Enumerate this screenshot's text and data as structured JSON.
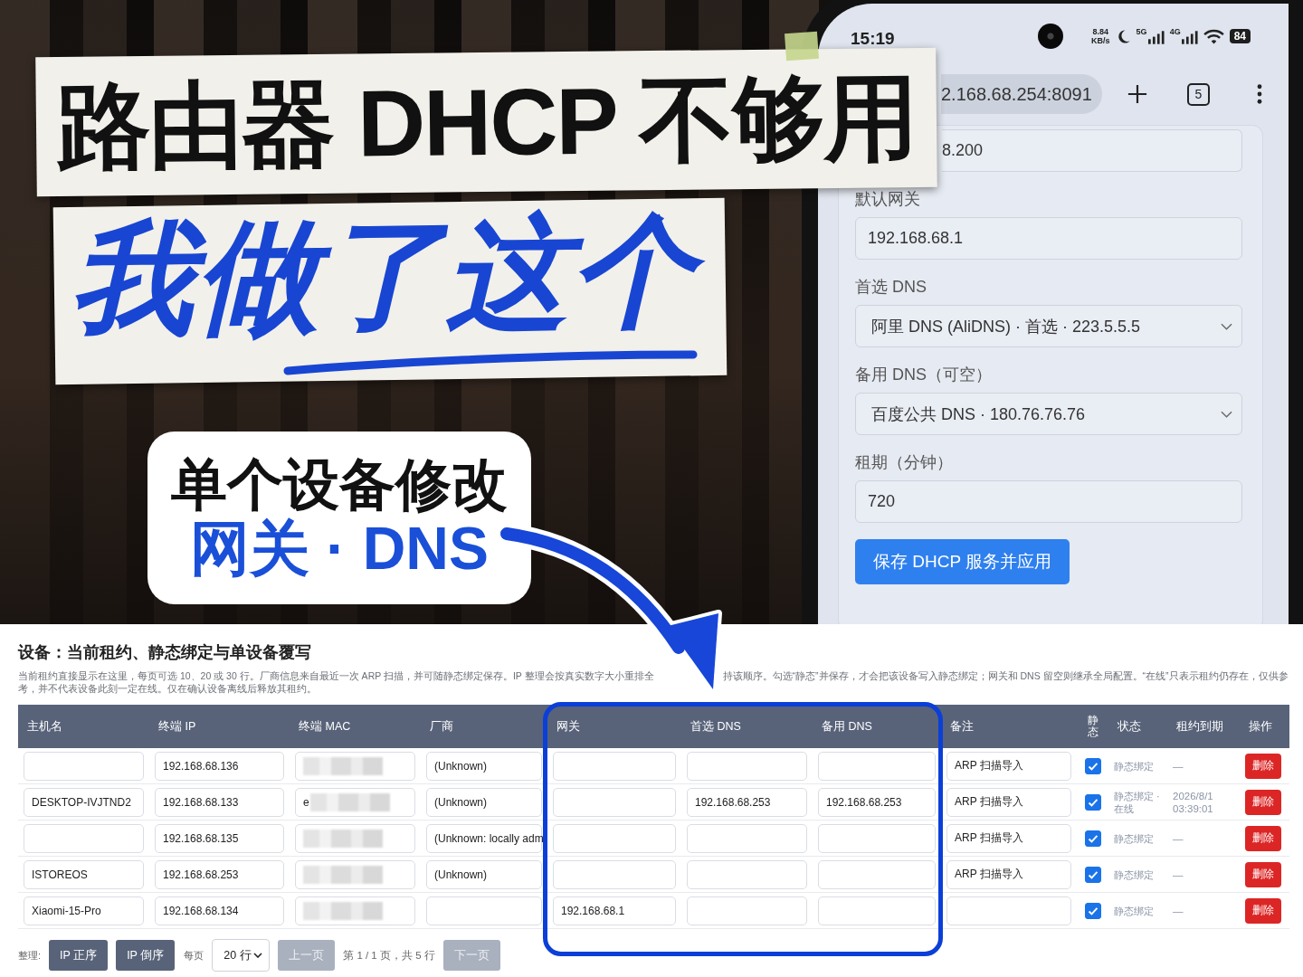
{
  "headline": {
    "line_1": "路由器 DHCP 不够用",
    "line_2": "我做了这个"
  },
  "callout": {
    "line_1": "单个设备修改",
    "line_2": "网关 · DNS"
  },
  "phone": {
    "status_bar": {
      "time": "15:19",
      "speed_value": "8.84",
      "speed_unit": "KB/s",
      "network_1": "5G",
      "network_2": "4G",
      "battery": "84"
    },
    "address_bar": {
      "url": "2.168.68.254:8091",
      "tab_count": "5"
    },
    "form": {
      "fields": [
        {
          "kind": "input",
          "value": "8.200"
        },
        {
          "kind": "input",
          "label": "默认网关",
          "value": "192.168.68.1"
        },
        {
          "kind": "select",
          "label": "首选 DNS",
          "value": "阿里 DNS (AliDNS) · 首选 · 223.5.5.5"
        },
        {
          "kind": "select",
          "label": "备用 DNS（可空）",
          "value": "百度公共 DNS · 180.76.76.76"
        },
        {
          "kind": "input",
          "label": "租期（分钟）",
          "value": "720"
        }
      ],
      "submit_button": "保存 DHCP 服务并应用"
    }
  },
  "devices": {
    "title": "设备：当前租约、静态绑定与单设备覆写",
    "description": [
      "当前租约直接显示在这里，每页可选 10、20 或 30 行。厂商信息来自最近一次 ARP 扫描，并可随静态绑定保存。IP 整理会按真实数字大小重排全",
      "持该顺序。勾选“静态”并保存，才会把该设备写入静态绑定；网关和 DNS 留空则继承全局配置。“在线”只表示租约仍存在，仅供参",
      "考，并不代表设备此刻一定在线。仅在确认设备离线后释放其租约。"
    ],
    "table": {
      "columns": [
        "主机名",
        "终端 IP",
        "终端 MAC",
        "厂商",
        "网关",
        "首选 DNS",
        "备用 DNS",
        "备注",
        "静态",
        "状态",
        "租约到期",
        "操作"
      ],
      "rows": [
        {
          "ip": "192.168.68.136",
          "mac": {
            "redacted": true
          },
          "vendor": "(Unknown)",
          "note": "ARP 扫描导入",
          "static": true,
          "status": "静态绑定",
          "lease_expires": "—",
          "action": "删除"
        },
        {
          "hostname": "DESKTOP-IVJTND2",
          "ip": "192.168.68.133",
          "mac": {
            "visible": "e",
            "redacted": true
          },
          "vendor": "(Unknown)",
          "dns_primary": "192.168.68.253",
          "dns_secondary": "192.168.68.253",
          "note": "ARP 扫描导入",
          "static": true,
          "status": "静态绑定 · 在线",
          "lease_expires": "2026/8/1 03:39:01",
          "action": "删除"
        },
        {
          "ip": "192.168.68.135",
          "mac": {
            "redacted": true
          },
          "vendor": "(Unknown: locally adm",
          "note": "ARP 扫描导入",
          "static": true,
          "status": "静态绑定",
          "lease_expires": "—",
          "action": "删除"
        },
        {
          "hostname": "ISTOREOS",
          "ip": "192.168.68.253",
          "mac": {
            "redacted": true
          },
          "vendor": "(Unknown)",
          "note": "ARP 扫描导入",
          "static": true,
          "status": "静态绑定",
          "lease_expires": "—",
          "action": "删除"
        },
        {
          "hostname": "Xiaomi-15-Pro",
          "ip": "192.168.68.134",
          "mac": {
            "redacted": true
          },
          "gateway": "192.168.68.1",
          "static": true,
          "status": "静态绑定",
          "lease_expires": "—",
          "action": "删除"
        }
      ]
    },
    "toolbar": {
      "label": "整理:",
      "sort_buttons": [
        {
          "label": "IP 正序",
          "disabled": false
        },
        {
          "label": "IP 倒序",
          "disabled": false
        }
      ],
      "page_size_label": "每页",
      "page_size": "20 行",
      "prev_button": {
        "label": "上一页",
        "disabled": true
      },
      "page_info": "第 1 / 1 页，共 5 行",
      "next_button": {
        "label": "下一页",
        "disabled": true
      }
    }
  }
}
